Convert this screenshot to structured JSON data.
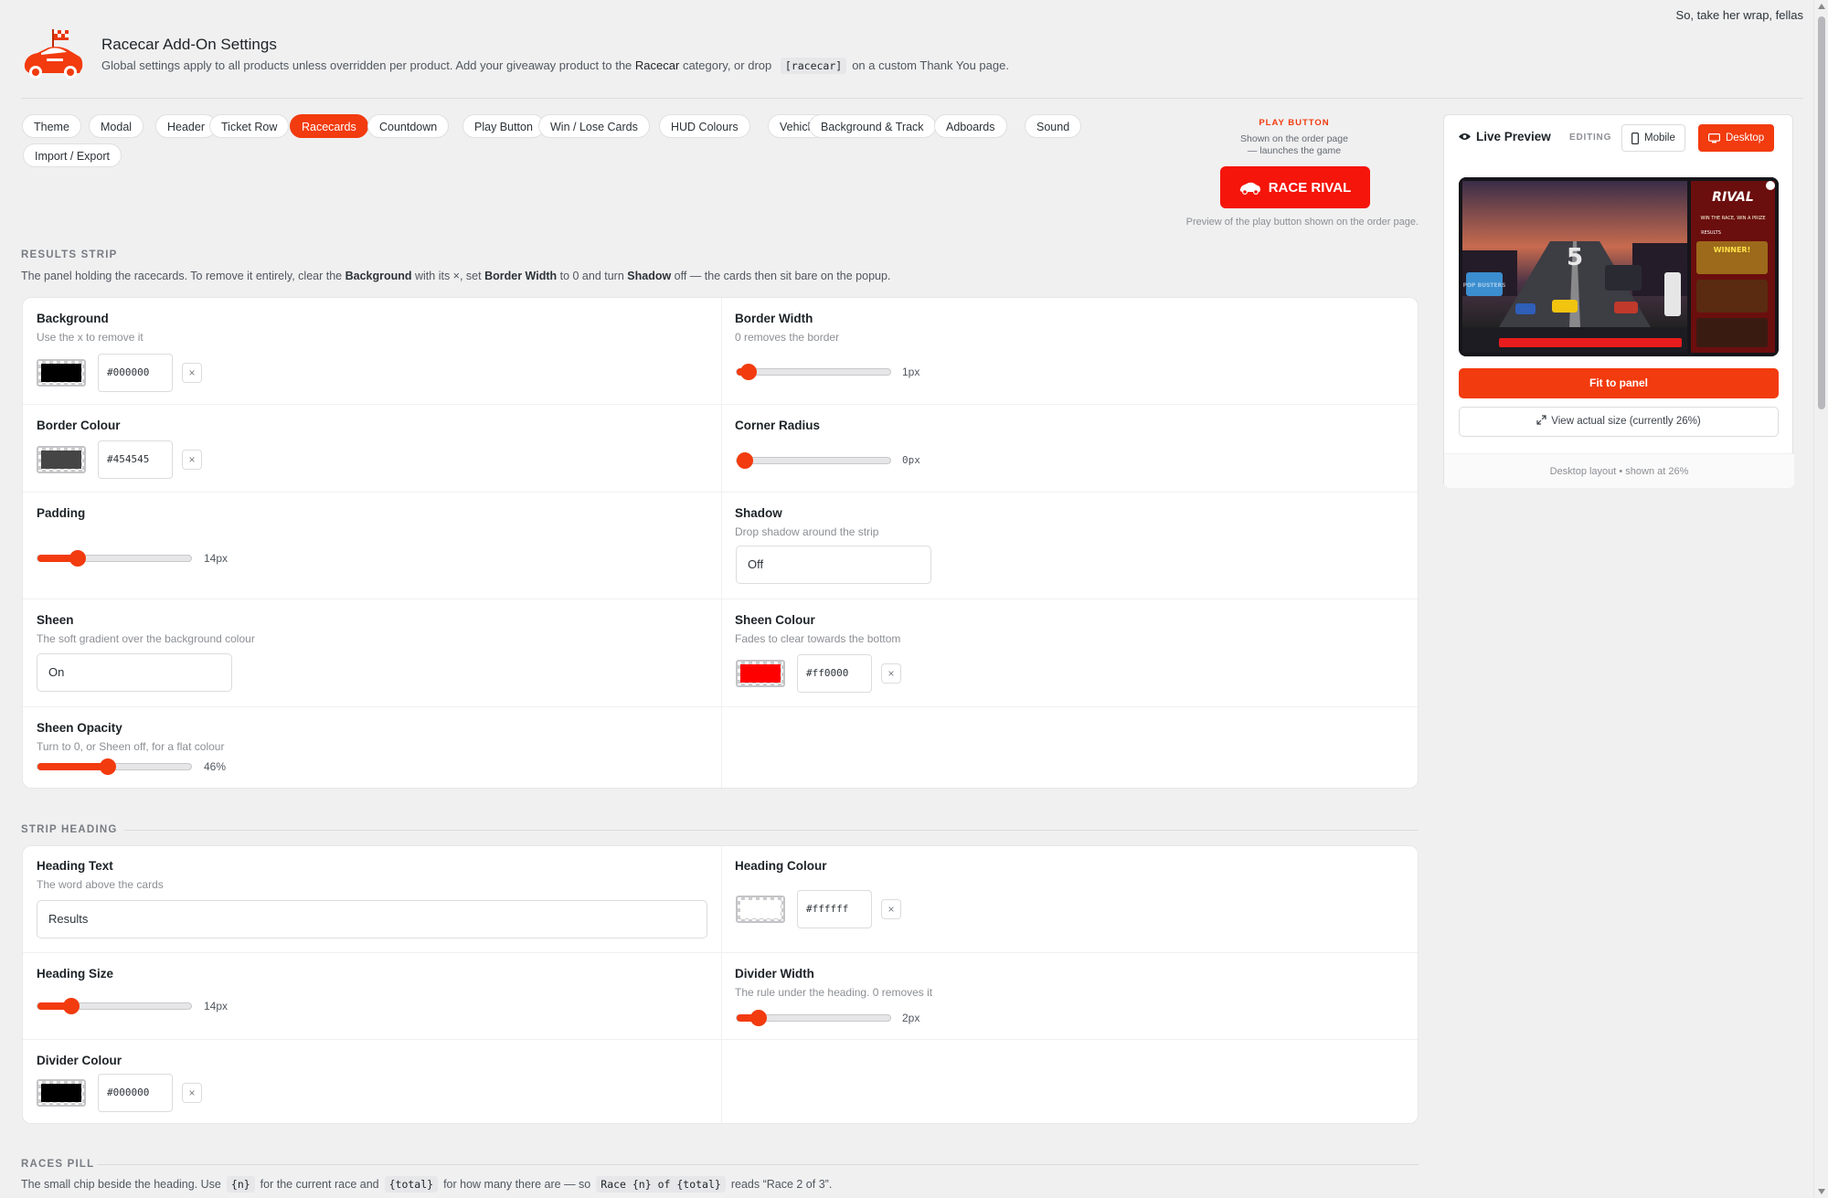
{
  "topbar": {
    "text": "So, take her wrap, fellas"
  },
  "header": {
    "title": "Racecar Add-On Settings",
    "subtitle_pre": "Global settings apply to all products unless overridden per product. Add your giveaway product to the ",
    "subtitle_bold": "Racecar",
    "subtitle_mid": " category, or drop ",
    "subtitle_code": "[racecar]",
    "subtitle_post": "on a custom Thank You page."
  },
  "tabs": [
    "Theme",
    "Modal",
    "Header",
    "Ticket Row",
    "Racecards",
    "Countdown",
    "Play Button",
    "Win / Lose Cards",
    "HUD Colours",
    "Vehicles",
    "Background & Track",
    "Adboards",
    "Sound",
    "Import / Export"
  ],
  "active_tab": "Racecards",
  "play_button_preview": {
    "title": "PLAY BUTTON",
    "desc_line1": "Shown on the order page",
    "desc_line2": "— launches the game",
    "button_label": "RACE RIVAL",
    "note": "Preview of the play button shown on the order page."
  },
  "results_strip": {
    "heading": "RESULTS STRIP",
    "desc_1": "The panel holding the racecards. To remove it entirely, clear the ",
    "desc_b1": "Background",
    "desc_2": " with its ×, set ",
    "desc_b2": "Border Width",
    "desc_3": " to 0 and turn ",
    "desc_b3": "Shadow",
    "desc_4": " off — the cards then sit bare on the popup.",
    "background": {
      "label": "Background",
      "desc": "Use the x to remove it",
      "hex": "#000000",
      "color": "#000000"
    },
    "border_width": {
      "label": "Border Width",
      "desc": "0 removes the border",
      "value_text": "1px",
      "fraction": 0.08
    },
    "border_colour": {
      "label": "Border Colour",
      "hex": "#454545",
      "color": "#454545"
    },
    "corner_radius": {
      "label": "Corner Radius",
      "value_text": "0px",
      "fraction": 0.0
    },
    "padding": {
      "label": "Padding",
      "value_text": "14px",
      "fraction": 0.26
    },
    "shadow": {
      "label": "Shadow",
      "desc": "Drop shadow around the strip",
      "value": "Off"
    },
    "sheen": {
      "label": "Sheen",
      "desc": "The soft gradient over the background colour",
      "value": "On"
    },
    "sheen_colour": {
      "label": "Sheen Colour",
      "desc": "Fades to clear towards the bottom",
      "hex": "#ff0000",
      "color": "#ff0000"
    },
    "sheen_opacity": {
      "label": "Sheen Opacity",
      "desc": "Turn to 0, or Sheen off, for a flat colour",
      "value_text": "46%",
      "fraction": 0.46
    }
  },
  "strip_heading": {
    "heading": "STRIP HEADING",
    "heading_text": {
      "label": "Heading Text",
      "desc": "The word above the cards",
      "value": "Results"
    },
    "heading_colour": {
      "label": "Heading Colour",
      "hex": "#ffffff",
      "color": "#ffffff"
    },
    "heading_size": {
      "label": "Heading Size",
      "value_text": "14px",
      "fraction": 0.22
    },
    "divider_width": {
      "label": "Divider Width",
      "desc": "The rule under the heading. 0 removes it",
      "value_text": "2px",
      "fraction": 0.14
    },
    "divider_colour": {
      "label": "Divider Colour",
      "hex": "#000000",
      "color": "#000000"
    }
  },
  "races_pill": {
    "heading": "RACES PILL",
    "desc_1": "The small chip beside the heading. Use",
    "code_1": "{n}",
    "desc_2": "for the current race and",
    "code_2": "{total}",
    "desc_3": "for how many there are — so",
    "code_3": "Race {n} of {total}",
    "desc_4": "reads “Race 2 of 3”."
  },
  "live_preview": {
    "title": "Live Preview",
    "editing": "EDITING",
    "mobile": "Mobile",
    "desktop": "Desktop",
    "fit_button": "Fit to panel",
    "actual_size": "View actual size (currently 26%)",
    "footer": "Desktop layout • shown at 26%",
    "game": {
      "countdown": "5",
      "brand": "RIVAL",
      "tagline": "WIN THE RACE, WIN A PRIZE",
      "results": "RESULTS",
      "winner": "WINNER!",
      "ad1": "POP BUSTERS"
    }
  },
  "icons": [
    "racecar-logo-icon",
    "close-icon",
    "eye-icon",
    "mobile-icon",
    "desktop-icon",
    "expand-icon",
    "car-icon"
  ],
  "colors": {
    "accent": "#f23b0e",
    "play_button": "#f5150a"
  }
}
